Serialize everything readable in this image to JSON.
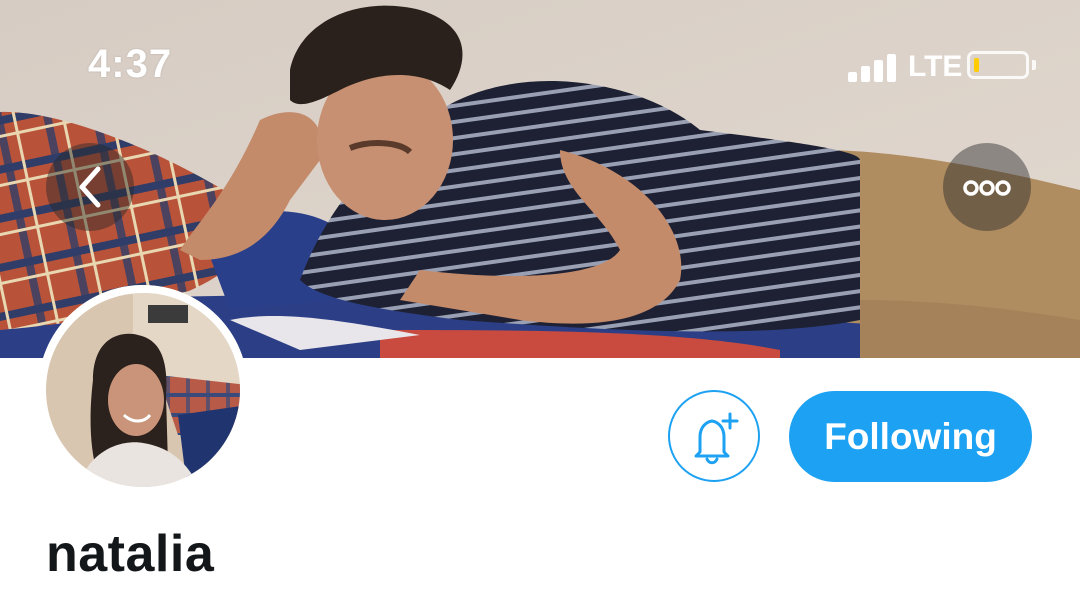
{
  "status_bar": {
    "time": "4:37",
    "network": "LTE",
    "battery_color": "#ffcc00"
  },
  "header": {
    "back_icon": "chevron-left-icon",
    "more_icon": "more-horizontal-icon"
  },
  "profile": {
    "display_name": "natalia",
    "notify_icon": "bell-plus-icon",
    "follow_button_label": "Following",
    "accent_color": "#1da1f2"
  }
}
